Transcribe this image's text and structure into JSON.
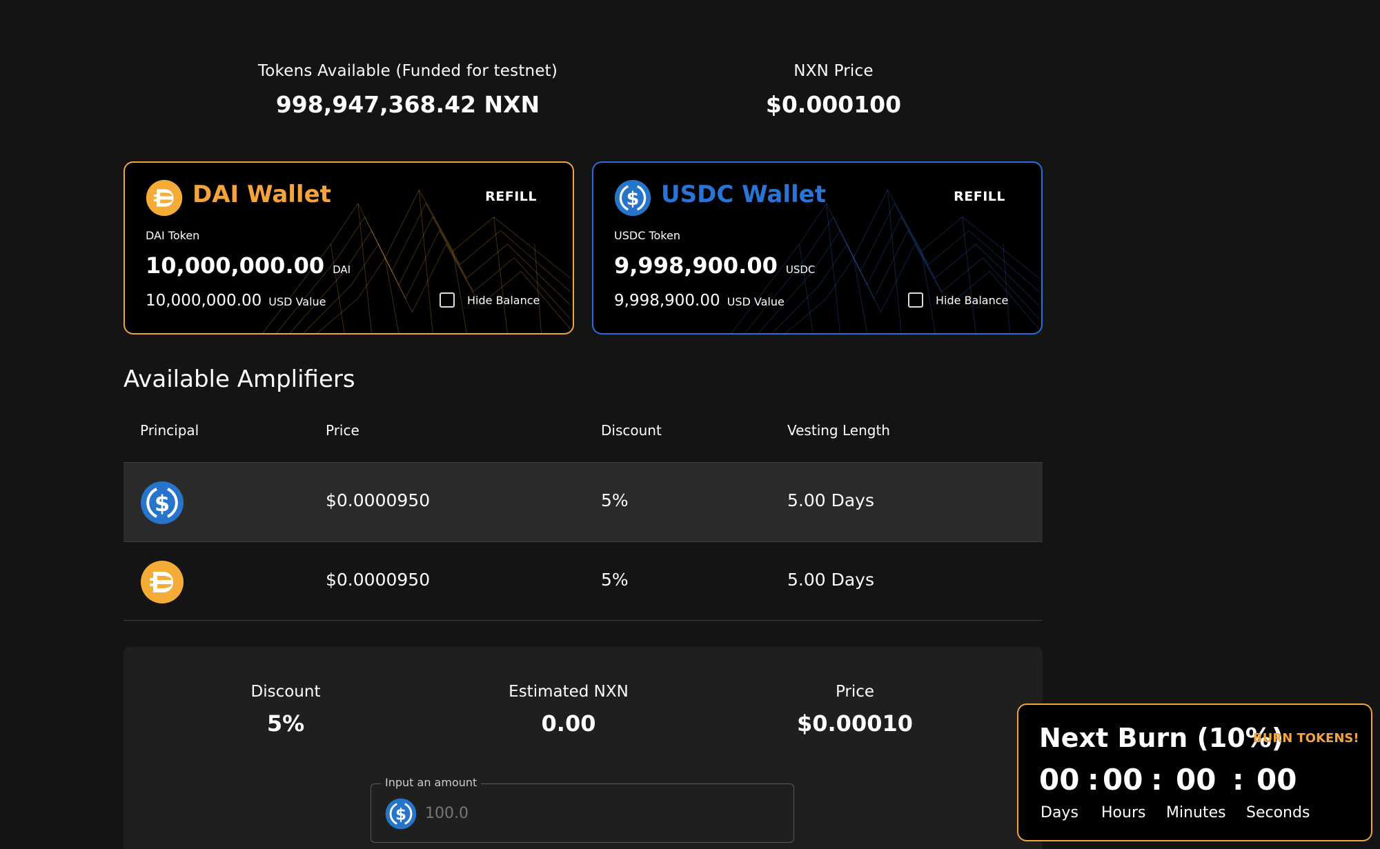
{
  "stats": {
    "tokens_label": "Tokens Available (Funded for testnet)",
    "tokens_value": "998,947,368.42 NXN",
    "price_label": "NXN Price",
    "price_value": "$0.000100"
  },
  "wallets": [
    {
      "title": "DAI Wallet",
      "refill": "REFILL",
      "token_label": "DAI Token",
      "balance": "10,000,000.00",
      "unit": "DAI",
      "usd_value": "10,000,000.00",
      "usd_label": "USD Value",
      "hide_label": "Hide Balance",
      "icon": "dai-icon",
      "accent": "#f5a33d"
    },
    {
      "title": "USDC Wallet",
      "refill": "REFILL",
      "token_label": "USDC Token",
      "balance": "9,998,900.00",
      "unit": "USDC",
      "usd_value": "9,998,900.00",
      "usd_label": "USD Value",
      "hide_label": "Hide Balance",
      "icon": "usdc-icon",
      "accent": "#2a74d6"
    }
  ],
  "amplifiers": {
    "title": "Available Amplifiers",
    "columns": [
      "Principal",
      "Price",
      "Discount",
      "Vesting Length"
    ],
    "rows": [
      {
        "icon": "usdc-icon",
        "price": "$0.0000950",
        "discount": "5%",
        "vesting": "5.00 Days"
      },
      {
        "icon": "dai-icon",
        "price": "$0.0000950",
        "discount": "5%",
        "vesting": "5.00 Days"
      }
    ]
  },
  "purchase": {
    "discount_label": "Discount",
    "discount_value": "5%",
    "estimated_label": "Estimated NXN",
    "estimated_value": "0.00",
    "price_label": "Price",
    "price_value": "$0.00010",
    "amount_legend": "Input an amount",
    "amount_placeholder": "100.0"
  },
  "burn": {
    "title": "Next Burn (10%)",
    "button": "BURN TOKENS!",
    "days": "00",
    "hours": "00",
    "minutes": "00",
    "seconds": "00",
    "days_label": "Days",
    "hours_label": "Hours",
    "minutes_label": "Minutes",
    "seconds_label": "Seconds",
    "separator": ":"
  },
  "colors": {
    "dai": "#f5a33d",
    "usdc": "#2a74d6",
    "background": "#141414"
  }
}
